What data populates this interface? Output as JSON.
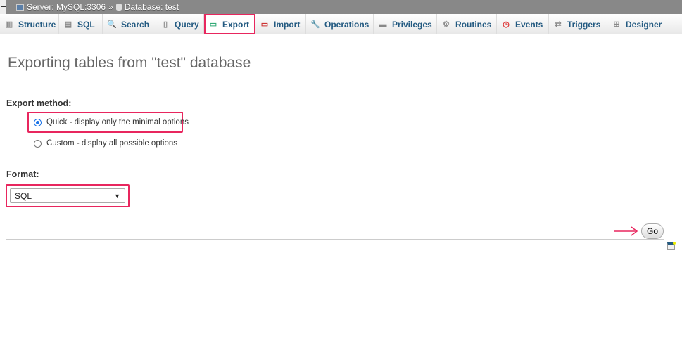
{
  "breadcrumb": {
    "server": "Server: MySQL:3306",
    "separator": "»",
    "database": "Database: test"
  },
  "tabs": [
    {
      "label": "Structure",
      "icon": "structure-icon"
    },
    {
      "label": "SQL",
      "icon": "sql-icon"
    },
    {
      "label": "Search",
      "icon": "search-icon"
    },
    {
      "label": "Query",
      "icon": "query-icon"
    },
    {
      "label": "Export",
      "icon": "export-icon",
      "active": true
    },
    {
      "label": "Import",
      "icon": "import-icon"
    },
    {
      "label": "Operations",
      "icon": "wrench-icon"
    },
    {
      "label": "Privileges",
      "icon": "privileges-icon"
    },
    {
      "label": "Routines",
      "icon": "routines-icon"
    },
    {
      "label": "Events",
      "icon": "clock-icon"
    },
    {
      "label": "Triggers",
      "icon": "triggers-icon"
    },
    {
      "label": "Designer",
      "icon": "designer-icon"
    }
  ],
  "page_title": "Exporting tables from \"test\" database",
  "export_method": {
    "label": "Export method:",
    "options": [
      {
        "label": "Quick - display only the minimal options",
        "checked": true
      },
      {
        "label": "Custom - display all possible options",
        "checked": false
      }
    ]
  },
  "format": {
    "label": "Format:",
    "selected": "SQL"
  },
  "go_label": "Go",
  "highlight_color": "#e8265e"
}
